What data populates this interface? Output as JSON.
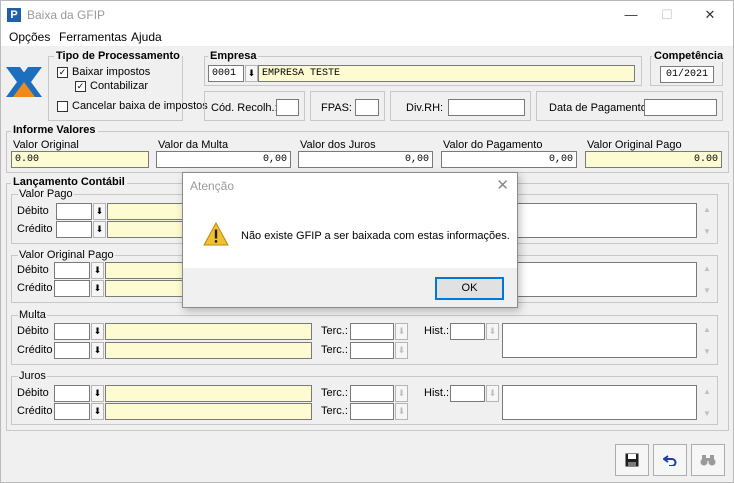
{
  "window": {
    "title": "Baixa da GFIP",
    "app_icon": "P",
    "minimize": "—",
    "maximize": "☐",
    "close": "✕"
  },
  "menu": [
    "Opções",
    "Ferramentas",
    "Ajuda"
  ],
  "processamento": {
    "title": "Tipo de Processamento",
    "baixar_impostos": {
      "label": "Baixar impostos",
      "checked": true
    },
    "contabilizar": {
      "label": "Contabilizar",
      "checked": true
    },
    "cancelar": {
      "label": "Cancelar baixa de impostos",
      "checked": false
    }
  },
  "empresa": {
    "title": "Empresa",
    "code": "0001",
    "name": "EMPRESA TESTE",
    "cod_recolh_label": "Cód. Recolh.:",
    "cod_recolh": "",
    "fpas_label": "FPAS:",
    "fpas": "",
    "divrh_label": "Div.RH:",
    "divrh": "",
    "data_pagamento_label": "Data de Pagamento:",
    "data_pagamento": ""
  },
  "competencia": {
    "title": "Competência",
    "value": "01/2021"
  },
  "informe": {
    "title": "Informe Valores",
    "fields": [
      {
        "label": "Valor Original",
        "value": "0.00"
      },
      {
        "label": "Valor da Multa",
        "value": "0,00"
      },
      {
        "label": "Valor dos Juros",
        "value": "0,00"
      },
      {
        "label": "Valor do Pagamento",
        "value": "0,00"
      },
      {
        "label": "Valor Original Pago",
        "value": "0.00"
      }
    ]
  },
  "lancamento": {
    "title": "Lançamento Contábil",
    "debito": "Débito",
    "credito": "Crédito",
    "terc": "Terc.:",
    "hist": "Hist.:",
    "sections": [
      "Valor Pago",
      "Valor Original Pago",
      "Multa",
      "Juros"
    ]
  },
  "toolbar": {
    "save_icon": "floppy-disk-icon",
    "undo_icon": "undo-icon",
    "search_icon": "binoculars-icon"
  },
  "dialog": {
    "title": "Atenção",
    "message": "Não existe GFIP a ser baixada com estas informações.",
    "ok": "OK",
    "close": "✕",
    "icon": "warning-icon"
  },
  "colors": {
    "yellow_field": "#fdfbd1",
    "accent": "#0078d7",
    "logo_blue": "#1c6fbf",
    "logo_orange": "#f08a1c"
  }
}
